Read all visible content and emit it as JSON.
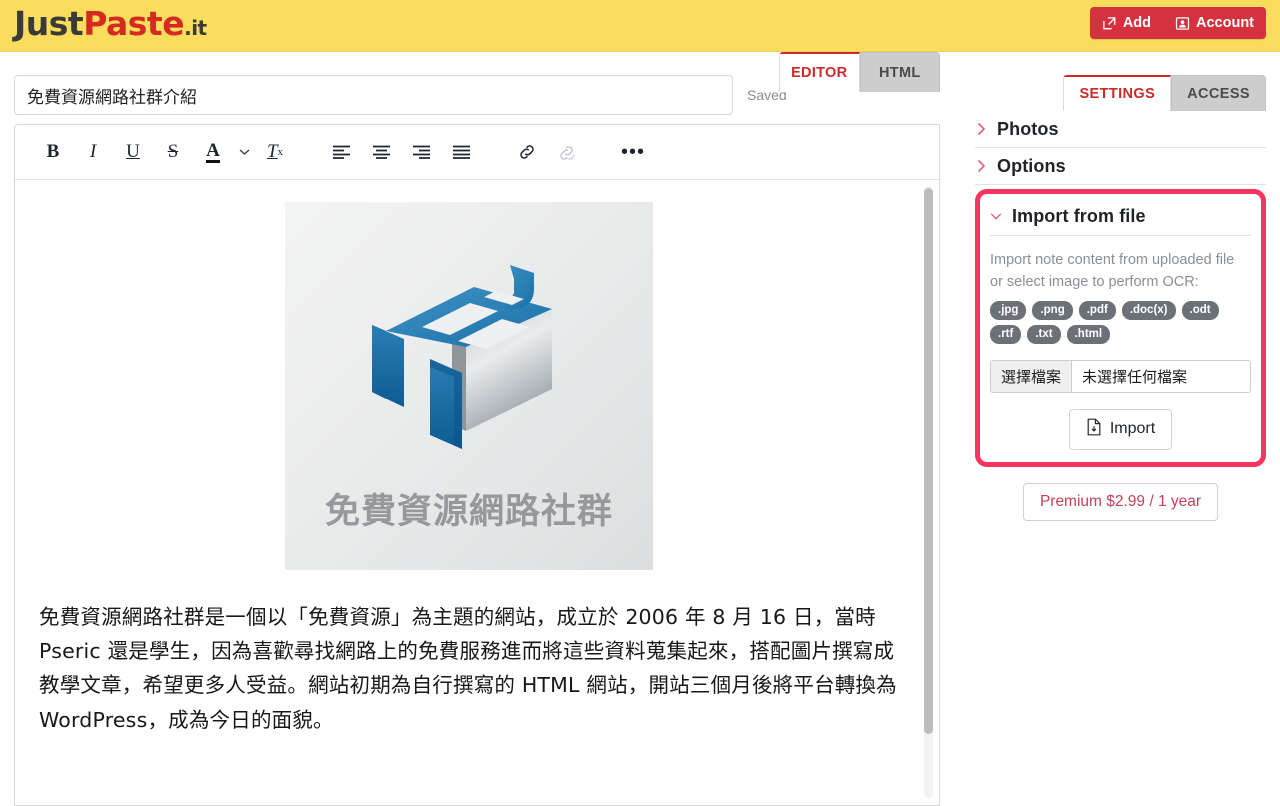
{
  "header": {
    "logo": {
      "part1": "Just",
      "part2": "Paste",
      "dot": ".",
      "part3": "it"
    },
    "buttons": [
      {
        "label": "Add",
        "icon": "edit-square-icon"
      },
      {
        "label": "Account",
        "icon": "user-card-icon"
      }
    ],
    "bg_color": "#fbdd5d",
    "button_color": "#d4323f"
  },
  "editor": {
    "title_value": "免費資源網路社群介紹",
    "title_placeholder": "Title",
    "saved_status": "Saved",
    "tabs": [
      {
        "label": "EDITOR",
        "active": true
      },
      {
        "label": "HTML",
        "active": false
      }
    ],
    "toolbar": [
      {
        "name": "bold",
        "glyph": "B"
      },
      {
        "name": "italic",
        "glyph": "I"
      },
      {
        "name": "underline",
        "glyph": "U"
      },
      {
        "name": "strikethrough",
        "glyph": "S"
      },
      {
        "name": "text-color",
        "glyph": "A"
      },
      {
        "name": "color-dropdown",
        "glyph": "⌄"
      },
      {
        "name": "remove-format",
        "glyph": "Tx"
      },
      {
        "name": "align-left",
        "glyph": "≡"
      },
      {
        "name": "align-center",
        "glyph": "≡"
      },
      {
        "name": "align-right",
        "glyph": "≡"
      },
      {
        "name": "align-justify",
        "glyph": "≡"
      },
      {
        "name": "insert-link",
        "glyph": "🔗"
      },
      {
        "name": "remove-link",
        "glyph": "🔗",
        "disabled": true
      },
      {
        "name": "more-options",
        "glyph": "•••"
      }
    ],
    "content": {
      "image_caption": "免費資源網路社群",
      "image_alt": "免費資源網路社群 logo",
      "paragraph": "免費資源網路社群是一個以「免費資源」為主題的網站，成立於 2006 年 8 月 16 日，當時 Pseric 還是學生，因為喜歡尋找網路上的免費服務進而將這些資料蒐集起來，搭配圖片撰寫成教學文章，希望更多人受益。網站初期為自行撰寫的 HTML 網站，開站三個月後將平台轉換為 WordPress，成為今日的面貌。"
    }
  },
  "sidebar": {
    "tabs": [
      {
        "label": "SETTINGS",
        "active": true
      },
      {
        "label": "ACCESS",
        "active": false
      }
    ],
    "sections": [
      {
        "label": "Photos",
        "expanded": false,
        "chevron": "›"
      },
      {
        "label": "Options",
        "expanded": false,
        "chevron": "›"
      }
    ],
    "import_panel": {
      "title": "Import from file",
      "chevron": "⌄",
      "expanded": true,
      "highlighted": true,
      "highlight_color": "#f5345f",
      "description": "Import note content from uploaded file or select image to perform OCR:",
      "extensions": [
        ".jpg",
        ".png",
        ".pdf",
        ".doc(x)",
        ".odt",
        ".rtf",
        ".txt",
        ".html"
      ],
      "file_button_label": "選擇檔案",
      "file_status": "未選擇任何檔案",
      "import_button_label": "Import",
      "import_button_icon": "file-download-icon"
    },
    "premium_button": "Premium $2.99 / 1 year"
  }
}
